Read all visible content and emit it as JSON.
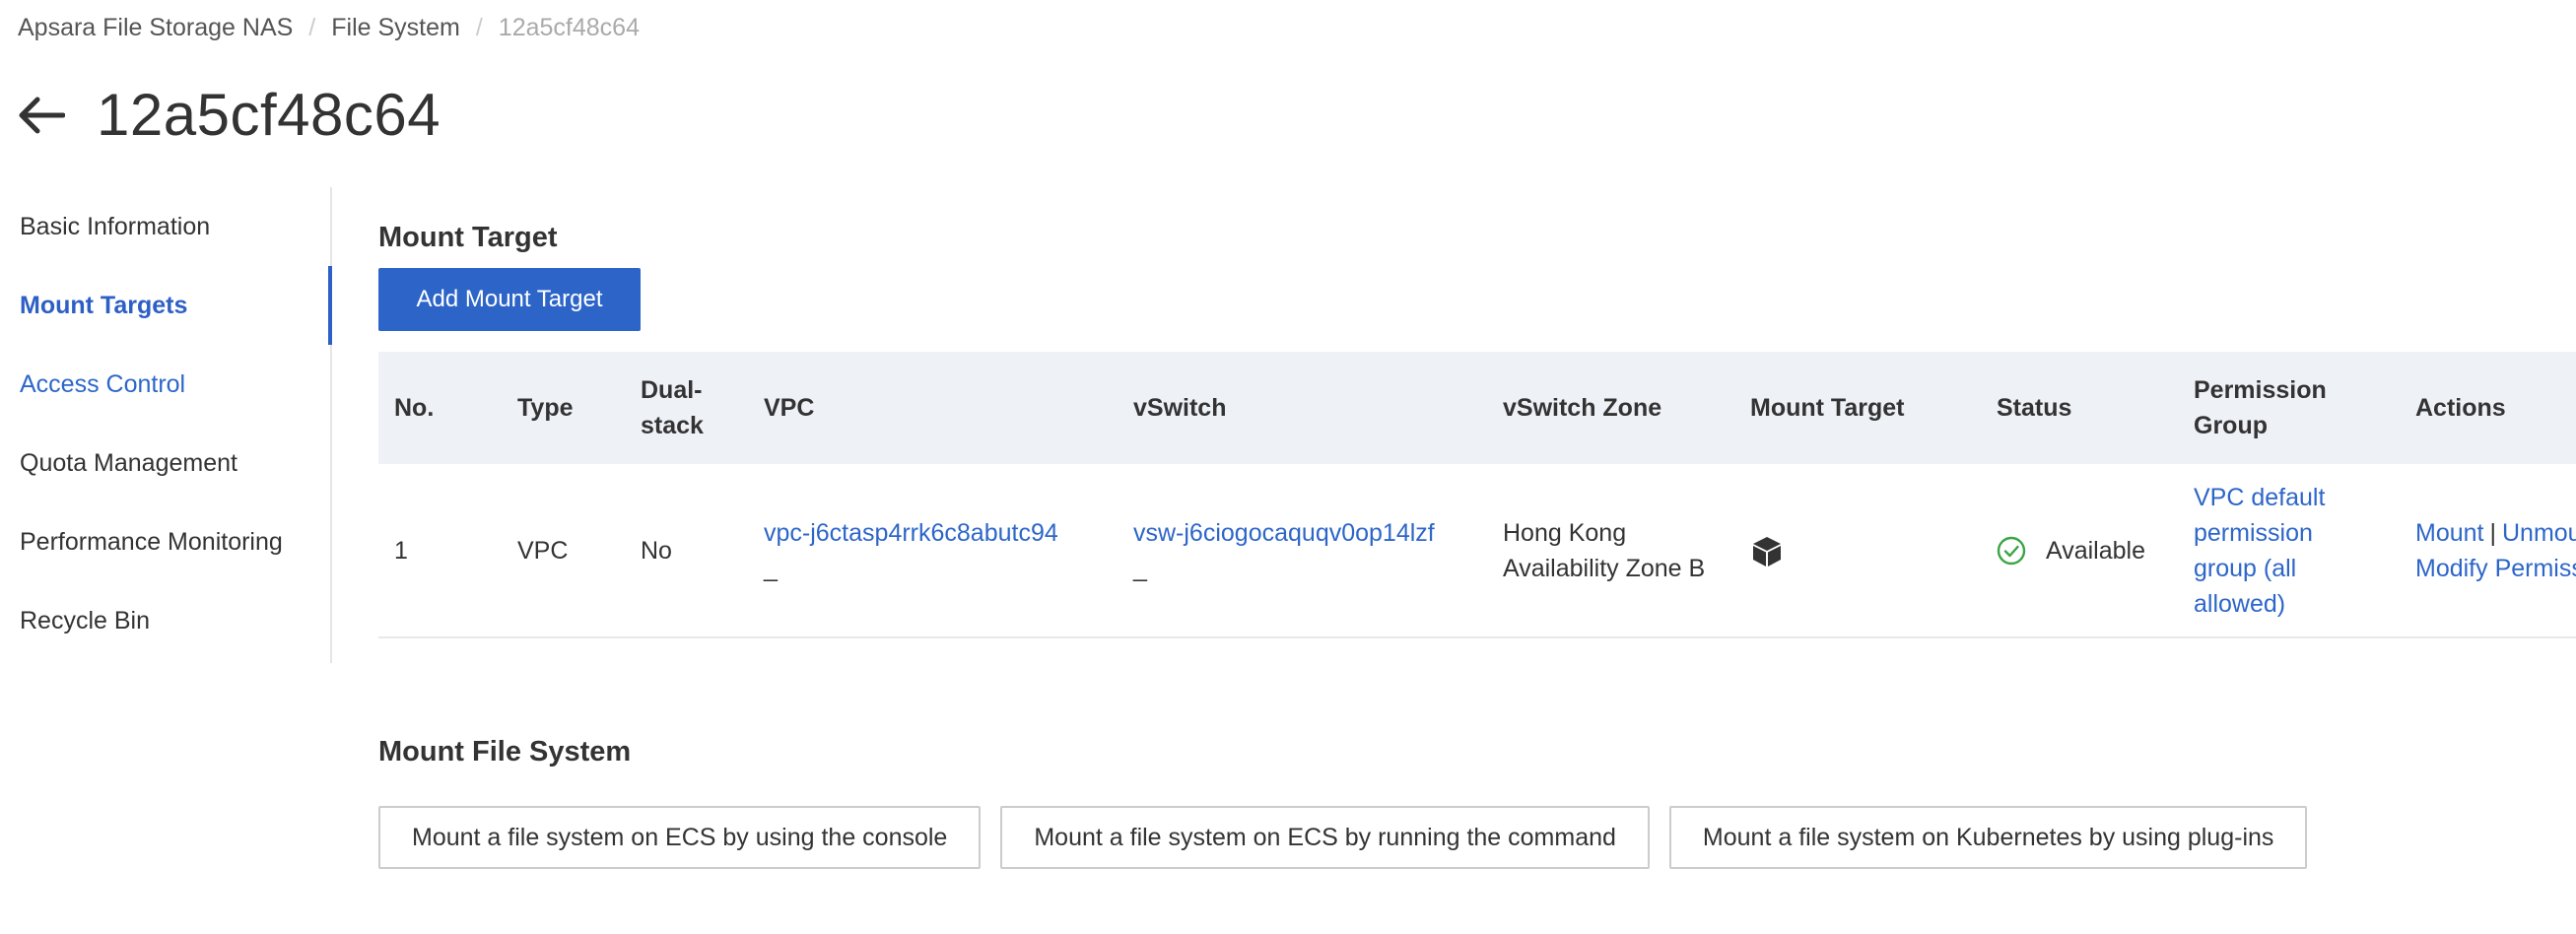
{
  "breadcrumb": {
    "items": [
      "Apsara File Storage NAS",
      "File System",
      "12a5cf48c64"
    ],
    "separator": "/"
  },
  "page": {
    "title": "12a5cf48c64"
  },
  "sidebar": {
    "items": [
      {
        "label": "Basic Information"
      },
      {
        "label": "Mount Targets"
      },
      {
        "label": "Access Control"
      },
      {
        "label": "Quota Management"
      },
      {
        "label": "Performance Monitoring"
      },
      {
        "label": "Recycle Bin"
      }
    ]
  },
  "mount_target_section": {
    "title": "Mount Target",
    "add_button": "Add Mount Target",
    "table": {
      "headers": {
        "no": "No.",
        "type": "Type",
        "dual_stack": "Dual-stack",
        "vpc": "VPC",
        "vswitch": "vSwitch",
        "vswitch_zone": "vSwitch Zone",
        "mount_target": "Mount Target",
        "status": "Status",
        "permission_group": "Permission Group",
        "actions": "Actions"
      },
      "rows": [
        {
          "no": "1",
          "type": "VPC",
          "dual_stack": "No",
          "vpc_id": "vpc-j6ctasp4rrk6c8abutc94",
          "vpc_sub": "_",
          "vswitch_id": "vsw-j6ciogocaquqv0op14lzf",
          "vswitch_sub": "_",
          "zone": "Hong Kong Availability Zone B",
          "mount_target_icon": "cube-icon",
          "status": "Available",
          "permission_group": "VPC default permission group (all allowed)",
          "action_mount": "Mount",
          "action_sep": "|",
          "action_unmount": "Unmount",
          "action_modify": "Modify Permission Group"
        }
      ]
    }
  },
  "mount_fs_section": {
    "title": "Mount File System",
    "buttons": [
      "Mount a file system on ECS by using the console",
      "Mount a file system on ECS by running the command",
      "Mount a file system on Kubernetes by using plug-ins"
    ]
  },
  "colors": {
    "primary": "#2d64c8",
    "link": "#2d66c9",
    "success": "#3aa544",
    "header_bg": "#eef1f6"
  }
}
